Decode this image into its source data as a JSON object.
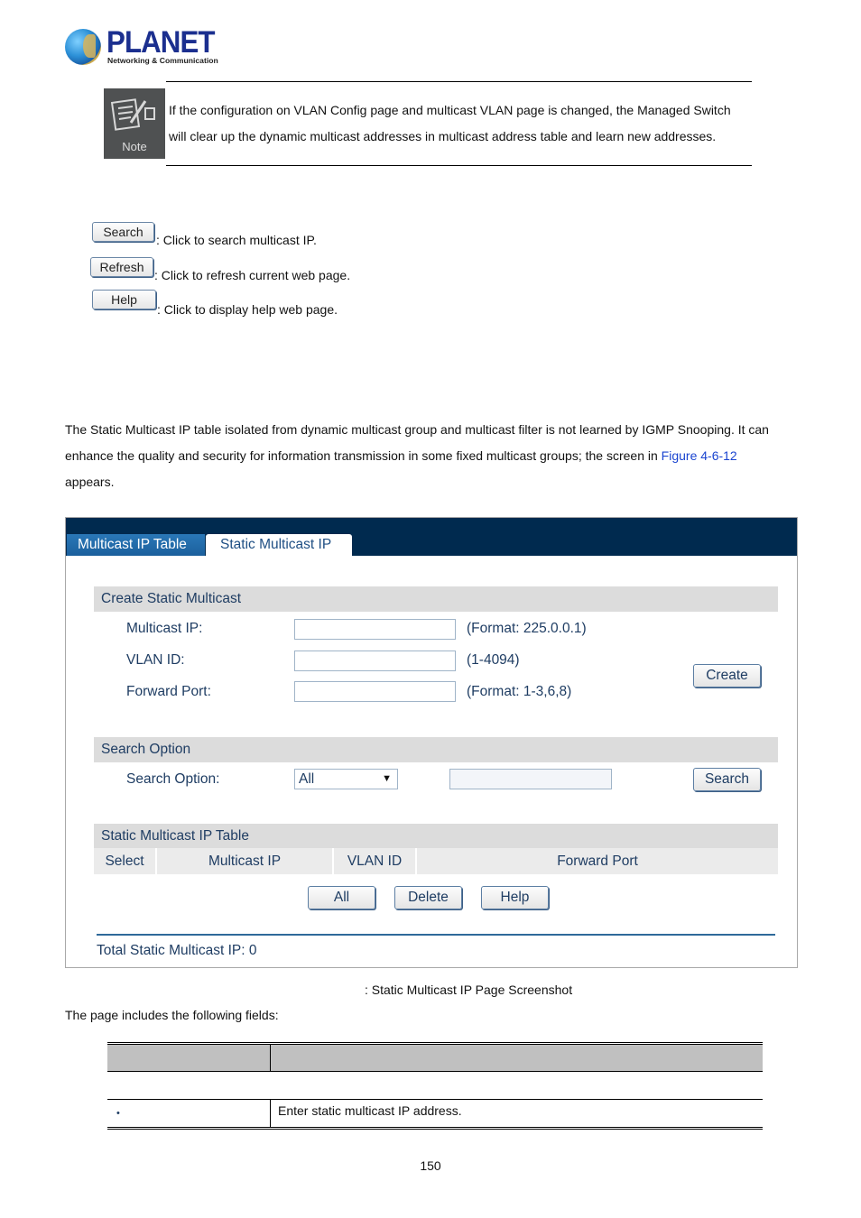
{
  "logo": {
    "brand": "PLANET",
    "tagline": "Networking & Communication"
  },
  "note": {
    "icon_label": "Note",
    "line1": "If the configuration on VLAN Config page and multicast VLAN page is changed, the Managed Switch",
    "line2": "will clear up the dynamic multicast addresses in multicast address table and learn new addresses."
  },
  "button_legend": [
    {
      "button": "Search",
      "description": ": Click to search multicast IP."
    },
    {
      "button": "Refresh",
      "description": ": Click to refresh current web page."
    },
    {
      "button": "Help",
      "description": ": Click to display help web page."
    }
  ],
  "paragraph": {
    "text_before_link": "The Static Multicast IP table isolated from dynamic multicast group and multicast filter is not learned by IGMP Snooping. It can enhance the quality and security for information transmission in some fixed multicast groups; the screen in ",
    "link_text": "Figure 4-6-12",
    "text_after_link": " appears."
  },
  "screenshot": {
    "tabs": [
      {
        "label": "Multicast IP Table",
        "active": false
      },
      {
        "label": "Static Multicast IP",
        "active": true
      }
    ],
    "create_section": {
      "title": "Create Static Multicast",
      "fields": [
        {
          "label": "Multicast IP:",
          "value": "",
          "hint": "(Format: 225.0.0.1)"
        },
        {
          "label": "VLAN ID:",
          "value": "",
          "hint": "(1-4094)"
        },
        {
          "label": "Forward Port:",
          "value": "",
          "hint": "(Format: 1-3,6,8)"
        }
      ],
      "create_button": "Create"
    },
    "search_section": {
      "title": "Search Option",
      "label": "Search Option:",
      "selected": "All",
      "search_value": "",
      "search_button": "Search"
    },
    "table_section": {
      "title": "Static Multicast IP Table",
      "columns": [
        "Select",
        "Multicast IP",
        "VLAN ID",
        "Forward Port"
      ],
      "rows": [],
      "buttons": [
        "All",
        "Delete",
        "Help"
      ]
    },
    "total_label": "Total Static Multicast IP: 0"
  },
  "caption": ": Static Multicast IP Page Screenshot",
  "fields_intro": "The page includes the following fields:",
  "fields_table": {
    "header": [
      "",
      ""
    ],
    "rows": [
      {
        "bullet": "•",
        "object": "",
        "description": "Enter static multicast IP address."
      }
    ]
  },
  "page_number": "150"
}
